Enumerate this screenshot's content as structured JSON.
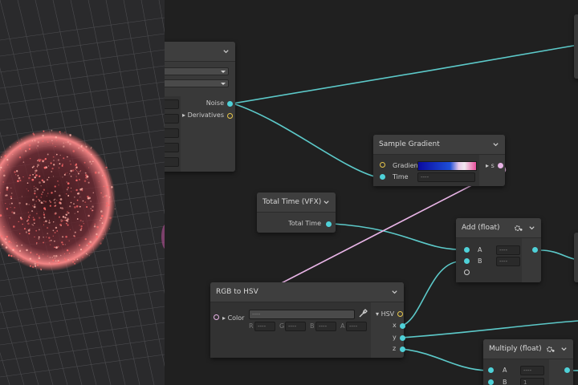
{
  "nodes": {
    "noise": {
      "out_noise": "Noise",
      "out_derivatives": "Derivatives"
    },
    "sample_gradient": {
      "title": "Sample Gradient",
      "in_gradient": "Gradient",
      "in_time": "Time",
      "time_value": "----",
      "out_s": "s",
      "gradient_colors": [
        "#0a0aa0",
        "#1e4fd6",
        "#e8c8e8",
        "#e84f9c"
      ]
    },
    "total_time": {
      "title": "Total Time (VFX)",
      "out": "Total Time"
    },
    "add": {
      "title": "Add (float)",
      "in_a": "A",
      "in_b": "B",
      "a_value": "----",
      "b_value": "----"
    },
    "rgb_to_hsv": {
      "title": "RGB to HSV",
      "in_color": "Color",
      "color_value": "----",
      "channels": [
        "R",
        "G",
        "B",
        "A"
      ],
      "channel_values": [
        "----",
        "----",
        "----",
        "----"
      ],
      "out_hsv": "HSV",
      "out_x": "x",
      "out_y": "y",
      "out_z": "z"
    },
    "multiply": {
      "title": "Multiply (float)",
      "in_a": "A",
      "in_b": "B",
      "a_value": "----",
      "b_value": "1"
    }
  },
  "colors": {
    "wire_float": "#5cc9c9",
    "wire_color": "#e8b4e6",
    "graph_bg": "#202020",
    "node_bg": "#393939"
  }
}
